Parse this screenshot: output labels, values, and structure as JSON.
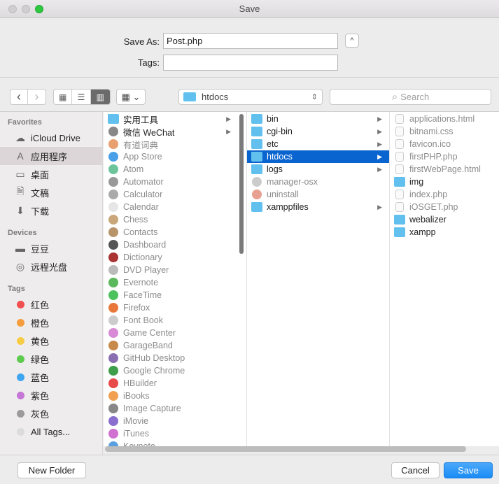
{
  "window": {
    "title": "Save"
  },
  "form": {
    "save_as_label": "Save As:",
    "save_as_value": "Post.php",
    "tags_label": "Tags:",
    "tags_value": "",
    "toggle_icon": "^"
  },
  "toolbar": {
    "back_icon": "‹",
    "forward_icon": "›",
    "view_icons": "▦",
    "view_list": "☰",
    "view_columns": "▥",
    "arrange": "▦ ⌄",
    "location": "htdocs",
    "location_arrows": "⇕",
    "search_placeholder": "Search",
    "search_icon": "⌕"
  },
  "sidebar": {
    "favorites_header": "Favorites",
    "favorites": [
      {
        "label": "iCloud Drive",
        "icon": "☁"
      },
      {
        "label": "应用程序",
        "icon": "A",
        "selected": true
      },
      {
        "label": "桌面",
        "icon": "▭"
      },
      {
        "label": "文稿",
        "icon": "🗎"
      },
      {
        "label": "下载",
        "icon": "⬇"
      }
    ],
    "devices_header": "Devices",
    "devices": [
      {
        "label": "豆豆",
        "icon": "▬"
      },
      {
        "label": "远程光盘",
        "icon": "◎"
      }
    ],
    "tags_header": "Tags",
    "tags": [
      {
        "label": "红色",
        "color": "#f0504f"
      },
      {
        "label": "橙色",
        "color": "#f59d3c"
      },
      {
        "label": "黄色",
        "color": "#f7cc45"
      },
      {
        "label": "绿色",
        "color": "#5ecb4e"
      },
      {
        "label": "蓝色",
        "color": "#3fa6f0"
      },
      {
        "label": "紫色",
        "color": "#c577d6"
      },
      {
        "label": "灰色",
        "color": "#9b9b9b"
      },
      {
        "label": "All Tags...",
        "color": "#dcdcdc"
      }
    ]
  },
  "columns": [
    [
      {
        "label": "实用工具",
        "type": "folder",
        "arrow": true
      },
      {
        "label": "微信 WeChat",
        "type": "app",
        "arrow": true,
        "color": "#888"
      },
      {
        "label": "有道词典",
        "dim": true,
        "color": "#e8a070"
      },
      {
        "label": "App Store",
        "dim": true,
        "color": "#4aa0e8"
      },
      {
        "label": "Atom",
        "dim": true,
        "color": "#6cc49a"
      },
      {
        "label": "Automator",
        "dim": true,
        "color": "#999"
      },
      {
        "label": "Calculator",
        "dim": true,
        "color": "#aaa"
      },
      {
        "label": "Calendar",
        "dim": true,
        "color": "#e6e6e6"
      },
      {
        "label": "Chess",
        "dim": true,
        "color": "#c9a77a"
      },
      {
        "label": "Contacts",
        "dim": true,
        "color": "#b8946a"
      },
      {
        "label": "Dashboard",
        "dim": true,
        "color": "#555"
      },
      {
        "label": "Dictionary",
        "dim": true,
        "color": "#a33"
      },
      {
        "label": "DVD Player",
        "dim": true,
        "color": "#bbb"
      },
      {
        "label": "Evernote",
        "dim": true,
        "color": "#5cb85c"
      },
      {
        "label": "FaceTime",
        "dim": true,
        "color": "#4cc25c"
      },
      {
        "label": "Firefox",
        "dim": true,
        "color": "#e8773a"
      },
      {
        "label": "Font Book",
        "dim": true,
        "color": "#ccc"
      },
      {
        "label": "Game Center",
        "dim": true,
        "color": "#d88ad6"
      },
      {
        "label": "GarageBand",
        "dim": true,
        "color": "#c88a4a"
      },
      {
        "label": "GitHub Desktop",
        "dim": true,
        "color": "#8a6fb0"
      },
      {
        "label": "Google Chrome",
        "dim": true,
        "color": "#3f9e4a"
      },
      {
        "label": "HBuilder",
        "dim": true,
        "color": "#e84a4a"
      },
      {
        "label": "iBooks",
        "dim": true,
        "color": "#f0a050"
      },
      {
        "label": "Image Capture",
        "dim": true,
        "color": "#888"
      },
      {
        "label": "iMovie",
        "dim": true,
        "color": "#8a6fd0"
      },
      {
        "label": "iTunes",
        "dim": true,
        "color": "#d070d0"
      },
      {
        "label": "Keynote",
        "dim": true,
        "color": "#5aa0e0"
      }
    ],
    [
      {
        "label": "bin",
        "type": "folder",
        "arrow": true
      },
      {
        "label": "cgi-bin",
        "type": "folder",
        "arrow": true
      },
      {
        "label": "etc",
        "type": "folder",
        "arrow": true
      },
      {
        "label": "htdocs",
        "type": "folder",
        "arrow": true,
        "selected": true
      },
      {
        "label": "logs",
        "type": "folder",
        "arrow": true
      },
      {
        "label": "manager-osx",
        "dim": true,
        "color": "#ccc"
      },
      {
        "label": "uninstall",
        "dim": true,
        "color": "#e8a090"
      },
      {
        "label": "xamppfiles",
        "type": "folder",
        "arrow": true
      }
    ],
    [
      {
        "label": "applications.html",
        "type": "file",
        "dim": true
      },
      {
        "label": "bitnami.css",
        "type": "file",
        "dim": true
      },
      {
        "label": "favicon.ico",
        "type": "file",
        "dim": true
      },
      {
        "label": "firstPHP.php",
        "type": "file",
        "dim": true
      },
      {
        "label": "firstWebPage.html",
        "type": "file",
        "dim": true
      },
      {
        "label": "img",
        "type": "folder"
      },
      {
        "label": "index.php",
        "type": "file",
        "dim": true
      },
      {
        "label": "iOSGET.php",
        "type": "file",
        "dim": true
      },
      {
        "label": "webalizer",
        "type": "folder"
      },
      {
        "label": "xampp",
        "type": "folder"
      }
    ]
  ],
  "buttons": {
    "new_folder": "New Folder",
    "cancel": "Cancel",
    "save": "Save"
  },
  "colors": {
    "accent": "#0a64d0",
    "save_button": "#1a8cf5",
    "folder": "#62c0ef"
  }
}
